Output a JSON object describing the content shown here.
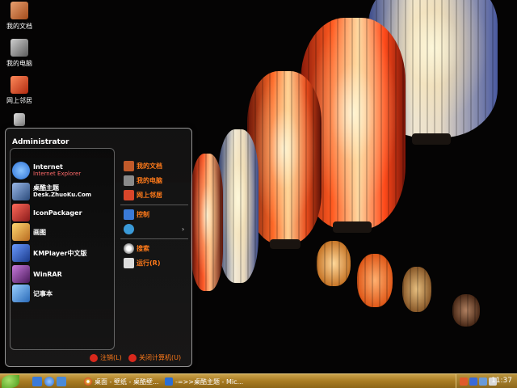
{
  "desktop": {
    "icons": [
      {
        "label": "我的文档",
        "icon": "my-documents-icon",
        "color": "#c25a2a"
      },
      {
        "label": "我的电脑",
        "icon": "my-computer-icon",
        "color": "#8a8a8a"
      },
      {
        "label": "网上邻居",
        "icon": "network-places-icon",
        "color": "#d9462a"
      },
      {
        "label": "",
        "icon": "recycle-bin-icon",
        "color": "#9a9a9a"
      }
    ]
  },
  "start_menu": {
    "user": "Administrator",
    "programs": [
      {
        "title": "Internet",
        "subtitle": "Internet Explorer",
        "icon": "ie-icon",
        "color": "#2a6fd6"
      },
      {
        "title": "桌酷主题",
        "subtitle": "Desk.ZhuoKu.Com",
        "icon": "zhuoku-icon",
        "color": "#3a5a8a"
      },
      {
        "title": "IconPackager",
        "subtitle": "",
        "icon": "iconpackager-icon",
        "color": "#b83232"
      },
      {
        "title": "画图",
        "subtitle": "",
        "icon": "paint-icon",
        "color": "#d8a030"
      },
      {
        "title": "KMPlayer中文版",
        "subtitle": "",
        "icon": "kmplayer-icon",
        "color": "#2a5cb8"
      },
      {
        "title": "WinRAR",
        "subtitle": "",
        "icon": "winrar-icon",
        "color": "#7a3a8a"
      },
      {
        "title": "记事本",
        "subtitle": "",
        "icon": "notepad-icon",
        "color": "#3a8ad8"
      }
    ],
    "places": [
      {
        "label": "我的文档",
        "icon": "my-documents-icon",
        "color": "#c25a2a"
      },
      {
        "label": "我的电脑",
        "icon": "my-computer-icon",
        "color": "#8a8a8a"
      },
      {
        "label": "网上邻居",
        "icon": "network-places-icon",
        "color": "#d9462a"
      },
      {
        "label": "控制",
        "icon": "control-panel-icon",
        "color": "#3a7ad8"
      },
      {
        "label": "",
        "icon": "connect-icon",
        "color": "#3a9ad8"
      },
      {
        "label": "搜索",
        "icon": "search-icon",
        "color": "#ddd"
      },
      {
        "label": "运行(R)",
        "icon": "run-icon",
        "color": "#ddd"
      }
    ],
    "logoff_label": "注销(L)",
    "shutdown_label": "关闭计算机(U)"
  },
  "taskbar": {
    "quick_launch": [
      {
        "icon": "show-desktop-icon",
        "color": "#3a7ad8"
      },
      {
        "icon": "ie-icon",
        "color": "#2a6fd6"
      },
      {
        "icon": "media-icon",
        "color": "#4a8ad8"
      }
    ],
    "tasks": [
      {
        "label": "桌面 - 壁纸 - 桌酷壁...",
        "icon": "chrome-icon",
        "color": "#e0b030"
      },
      {
        "label": "-=>>桌酷主题 - Mic...",
        "icon": "window-icon",
        "color": "#2a6fd6"
      }
    ],
    "tray_icons": [
      {
        "icon": "tray-orange-icon",
        "color": "#e05a2a"
      },
      {
        "icon": "tray-blue-icon",
        "color": "#3a6ad8"
      },
      {
        "icon": "tray-network-icon",
        "color": "#6a9ad8"
      },
      {
        "icon": "tray-volume-icon",
        "color": "#d8d8d8"
      }
    ],
    "clock": "11:37"
  }
}
